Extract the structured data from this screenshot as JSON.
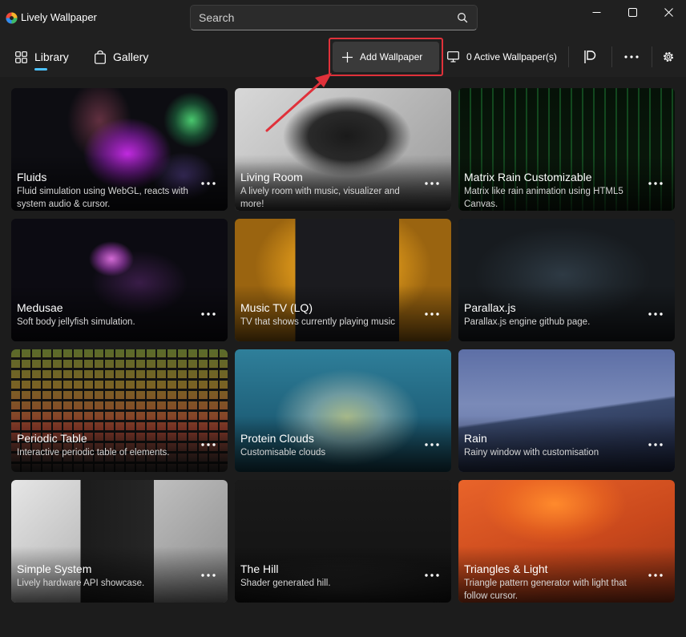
{
  "app": {
    "title": "Lively Wallpaper"
  },
  "search": {
    "placeholder": "Search"
  },
  "nav": {
    "library_label": "Library",
    "gallery_label": "Gallery",
    "add_wallpaper_label": "Add Wallpaper",
    "active_wallpapers_label": "0 Active Wallpaper(s)"
  },
  "colors": {
    "accent": "#4cc2ff",
    "highlight_outline": "#e0313a",
    "background": "#202020"
  },
  "wallpapers": [
    {
      "title": "Fluids",
      "description": "Fluid simulation using WebGL, reacts with system audio & cursor."
    },
    {
      "title": "Living Room",
      "description": "A lively room with music, visualizer and more!"
    },
    {
      "title": "Matrix Rain Customizable",
      "description": "Matrix like rain animation using HTML5 Canvas."
    },
    {
      "title": "Medusae",
      "description": "Soft body jellyfish simulation."
    },
    {
      "title": "Music TV (LQ)",
      "description": "TV that shows currently playing music"
    },
    {
      "title": "Parallax.js",
      "description": "Parallax.js engine github page."
    },
    {
      "title": "Periodic Table",
      "description": "Interactive periodic table of elements."
    },
    {
      "title": "Protein Clouds",
      "description": "Customisable clouds"
    },
    {
      "title": "Rain",
      "description": "Rainy window with customisation"
    },
    {
      "title": "Simple System",
      "description": "Lively hardware API showcase."
    },
    {
      "title": "The Hill",
      "description": "Shader generated hill."
    },
    {
      "title": "Triangles & Light",
      "description": "Triangle pattern generator with light that follow cursor."
    }
  ]
}
